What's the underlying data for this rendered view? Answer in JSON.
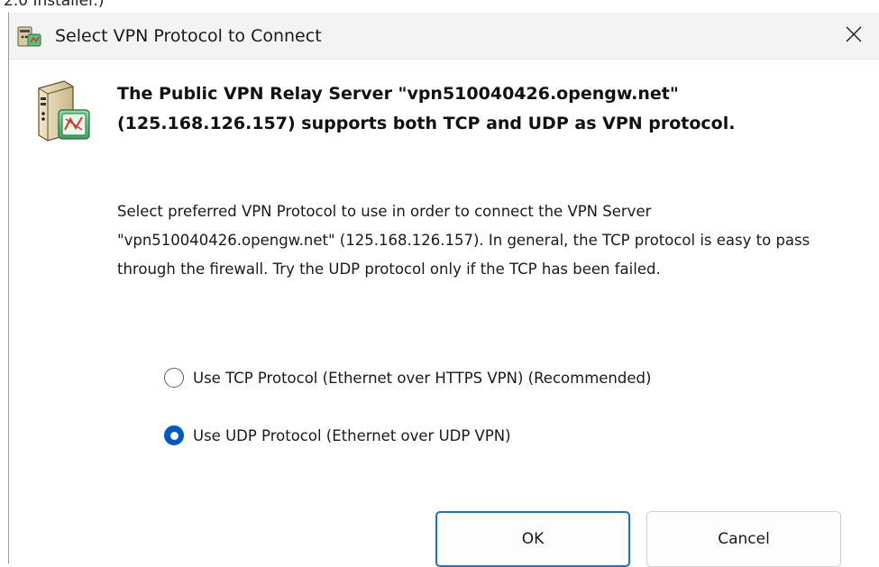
{
  "background_fragment": "2.0 Installer.)",
  "window": {
    "title": "Select VPN Protocol to Connect",
    "close_glyph": "✕"
  },
  "message": {
    "headline": "The Public VPN Relay Server \"vpn510040426.opengw.net\" (125.168.126.157) supports both TCP and UDP as VPN protocol.",
    "description": "Select preferred VPN Protocol to use in order to connect the VPN Server \"vpn510040426.opengw.net\" (125.168.126.157). In general, the TCP protocol is easy to pass through the firewall. Try the UDP protocol only if the TCP has been failed."
  },
  "options": [
    {
      "label": "Use TCP Protocol (Ethernet over HTTPS VPN) (Recommended)",
      "selected": false
    },
    {
      "label": "Use UDP Protocol (Ethernet over UDP VPN)",
      "selected": true
    }
  ],
  "buttons": {
    "ok_label": "OK",
    "cancel_label": "Cancel"
  },
  "colors": {
    "accent": "#0058c7",
    "ok_border": "#1a6fd0",
    "titlebar": "#f3f3f3"
  },
  "icons": {
    "window": "vpn-server-icon",
    "message": "vpn-server-icon",
    "close": "close-icon"
  }
}
